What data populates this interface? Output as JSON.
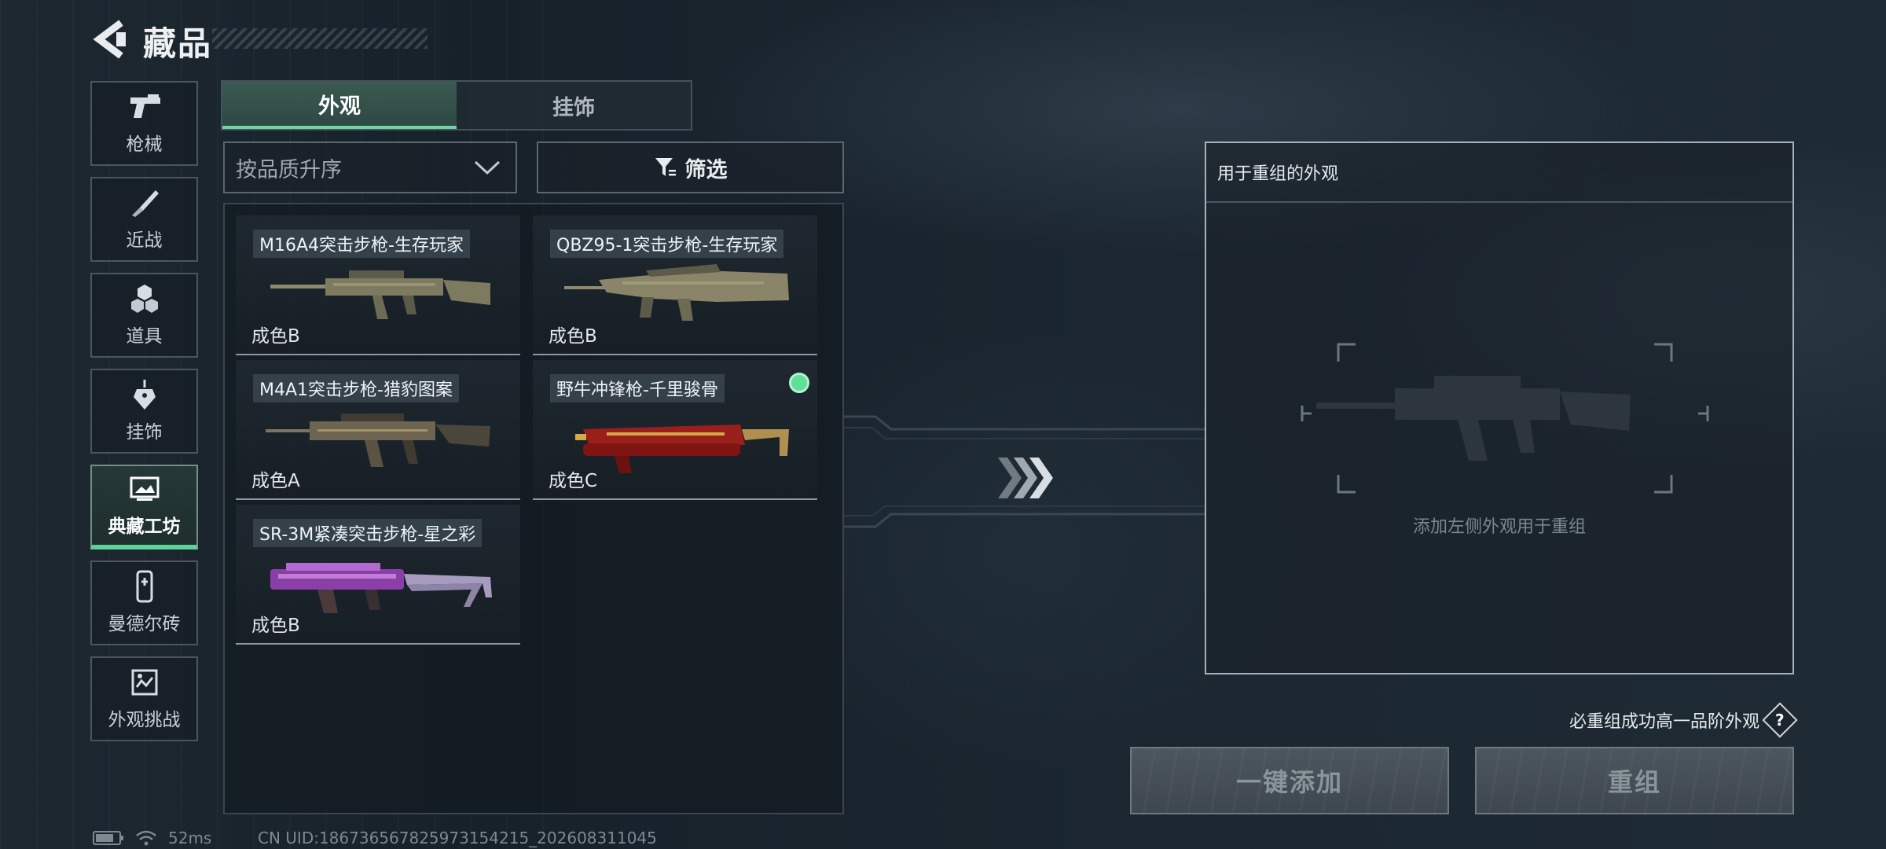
{
  "header": {
    "title": "藏品",
    "back_icon": "back-arrow-icon"
  },
  "sidebar": {
    "items": [
      {
        "label": "枪械",
        "icon": "pistol-icon",
        "active": false
      },
      {
        "label": "近战",
        "icon": "knife-icon",
        "active": false
      },
      {
        "label": "道具",
        "icon": "cubes-icon",
        "active": false
      },
      {
        "label": "挂饰",
        "icon": "charm-tag-icon",
        "active": false
      },
      {
        "label": "典藏工坊",
        "icon": "gallery-icon",
        "active": true
      },
      {
        "label": "曼德尔砖",
        "icon": "brick-icon",
        "active": false
      },
      {
        "label": "外观挑战",
        "icon": "challenge-icon",
        "active": false
      }
    ]
  },
  "tabs": [
    {
      "label": "外观",
      "active": true
    },
    {
      "label": "挂饰",
      "active": false
    }
  ],
  "sort": {
    "label": "按品质升序"
  },
  "filter": {
    "label": "筛选"
  },
  "items": [
    {
      "name": "M16A4突击步枪-生存玩家",
      "grade": "成色B",
      "owned": false,
      "skin": "camo-tan"
    },
    {
      "name": "QBZ95-1突击步枪-生存玩家",
      "grade": "成色B",
      "owned": false,
      "skin": "camo-tan"
    },
    {
      "name": "M4A1突击步枪-猎豹图案",
      "grade": "成色A",
      "owned": false,
      "skin": "leopard"
    },
    {
      "name": "野牛冲锋枪-千里骏骨",
      "grade": "成色C",
      "owned": true,
      "skin": "red-gold"
    },
    {
      "name": "SR-3M紧凑突击步枪-星之彩",
      "grade": "成色B",
      "owned": false,
      "skin": "purple-star"
    }
  ],
  "recombine": {
    "panel_title": "用于重组的外观",
    "placeholder": "添加左侧外观用于重组",
    "guarantee": "必重组成功高一品阶外观",
    "help_icon": "question-icon",
    "add_all_label": "一键添加",
    "recombine_label": "重组"
  },
  "status": {
    "ping": "52ms",
    "uid": "CN UID:18673656782597315421​5_202608311045"
  },
  "colors": {
    "accent": "#5fd29a",
    "panel_border": "#a9b1b8"
  }
}
